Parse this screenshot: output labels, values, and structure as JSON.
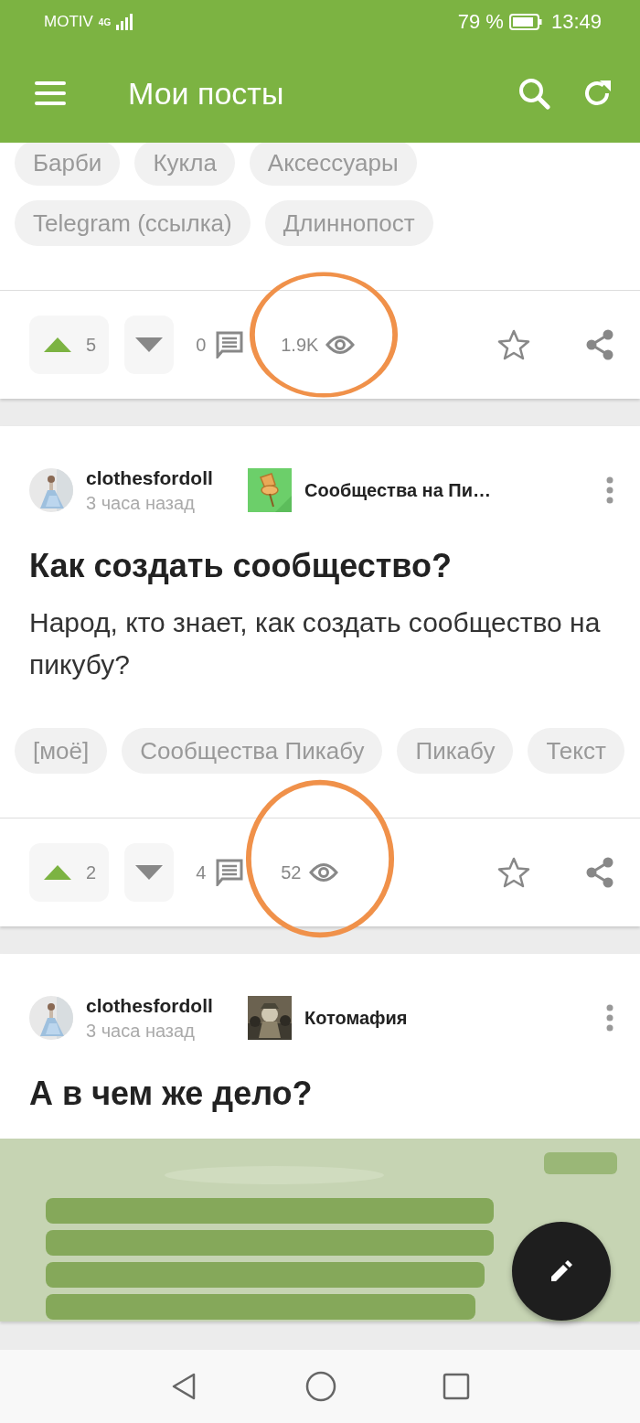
{
  "status_bar": {
    "carrier": "MOTIV",
    "network": "4G",
    "battery": "79 %",
    "time": "13:49"
  },
  "app_bar": {
    "title": "Мои посты"
  },
  "posts": [
    {
      "tags": [
        "Барби",
        "Кукла",
        "Аксессуары",
        "Telegram (ссылка)",
        "Длиннопост"
      ],
      "rating_up": "5",
      "comments": "0",
      "views": "1.9K",
      "views_highlighted": true
    },
    {
      "author": "clothesfordoll",
      "time": "3 часа назад",
      "community": "Сообщества на Пи…",
      "community_avatar": {
        "kind": "pin"
      },
      "title": "Как создать сообщество?",
      "body": "Народ, кто знает, как создать сообщество на пикубу?",
      "tags": [
        "[моё]",
        "Сообщества Пикабу",
        "Пикабу",
        "Текст"
      ],
      "rating_up": "2",
      "comments": "4",
      "views": "52",
      "views_highlighted": true
    },
    {
      "author": "clothesfordoll",
      "time": "3 часа назад",
      "community": "Котомафия",
      "title": "А в чем же дело?"
    }
  ]
}
